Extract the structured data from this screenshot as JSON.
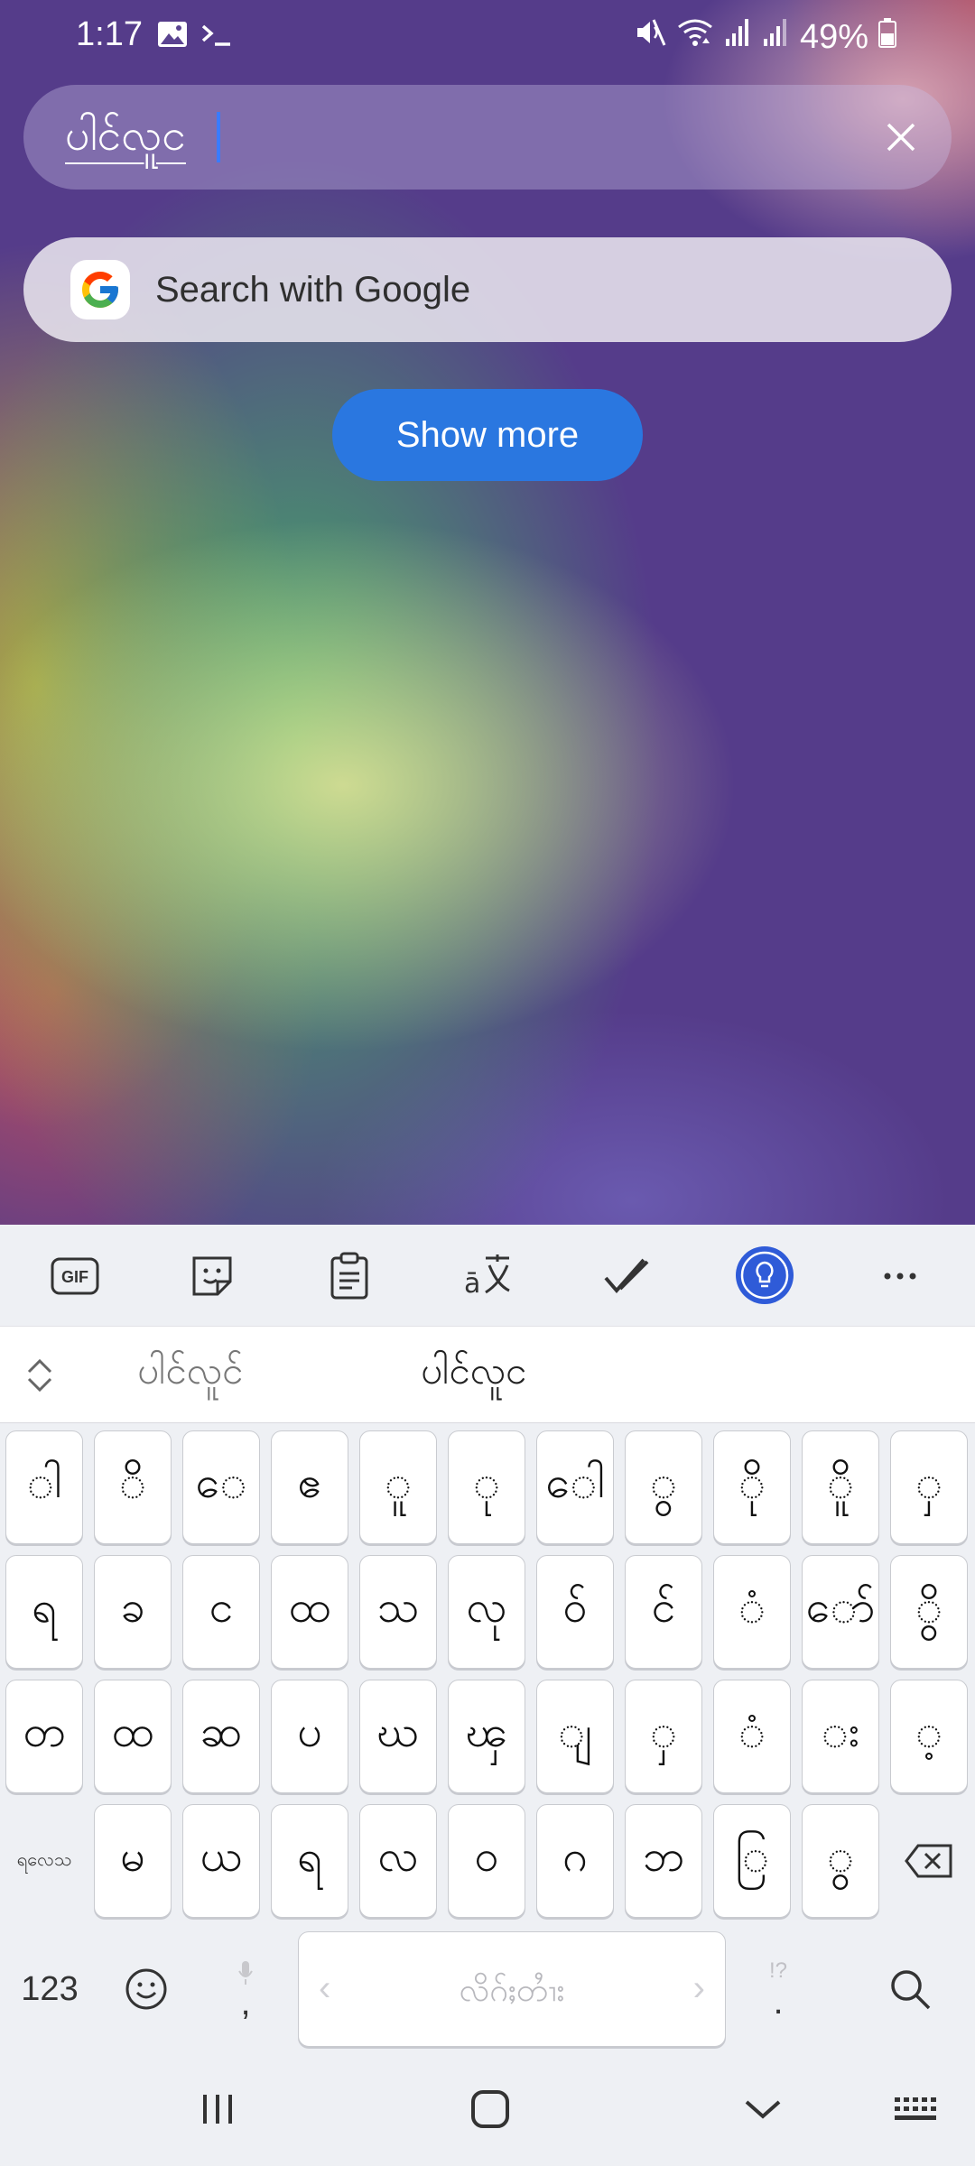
{
  "status_bar": {
    "time": "1:17",
    "battery": "49%",
    "icons_left": [
      "gallery-icon",
      "terminal-icon"
    ],
    "icons_right": [
      "mute-icon",
      "wifi-icon",
      "signal-icon",
      "signal-icon-2",
      "battery-icon"
    ]
  },
  "search": {
    "value": "ပါင်လူင",
    "clear_icon": "close-icon"
  },
  "google_suggestion": {
    "label": "Search with Google",
    "icon": "google-logo-icon"
  },
  "show_more": {
    "label": "Show more"
  },
  "keyboard": {
    "toolbar": [
      "gif-icon",
      "sticker-icon",
      "clipboard-icon",
      "translate-icon",
      "spellcheck-icon",
      "bulb-icon",
      "more-icon"
    ],
    "toolbar_gif_label": "GIF",
    "suggestions": [
      "ပါင်လူင်",
      "ပါင်လူင"
    ],
    "rows": [
      [
        "ါ",
        "ိ",
        "ေ",
        "ဧ",
        "ူ",
        "ု",
        "ေါ",
        "ွ",
        "ို",
        "ိူ",
        "ှ"
      ],
      [
        "ရ",
        "ခ",
        "င",
        "ထ",
        "သ",
        "လု",
        "ဝ်",
        "င်",
        "ံ",
        "ော်",
        "ွိ"
      ],
      [
        "တ",
        "ထ",
        "ဆ",
        "ပ",
        "ဃ",
        "ၾ",
        "ျ",
        "ှ",
        "ံ",
        "း",
        "့"
      ],
      [
        "မ",
        "ယ",
        "ရ",
        "လ",
        "ဝ",
        "ဂ",
        "ဘ",
        "ြ",
        "ွ"
      ]
    ],
    "lang_key": "ရလေသ",
    "num_key": "123",
    "comma_key": ",",
    "period_key": ".",
    "punct_hint": "!?",
    "space_label": "လိဂ်ႈတၢႆး",
    "space_left": "‹",
    "space_right": "›"
  },
  "accent_color": "#2a77e0"
}
